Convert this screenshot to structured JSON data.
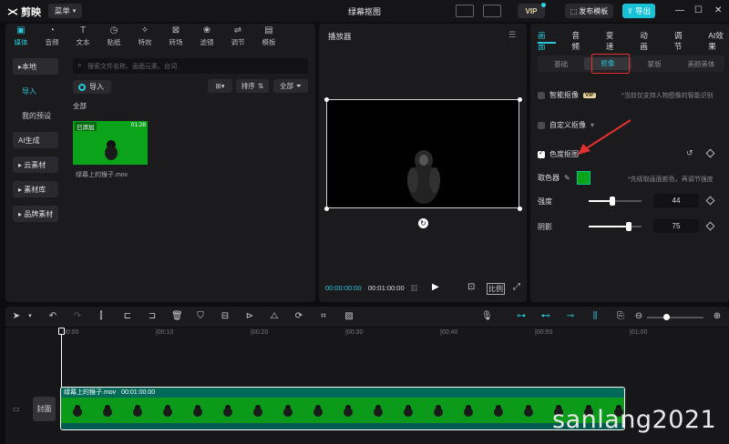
{
  "app": {
    "logo_text": "剪映",
    "menu_label": "菜单",
    "project_title": "绿幕抠图",
    "vip_label": "VIP",
    "publish_label": "发布模板",
    "export_label": "导出"
  },
  "media_tools": [
    {
      "label": "媒体",
      "icon": "media-icon",
      "active": true
    },
    {
      "label": "音频",
      "icon": "audio-icon"
    },
    {
      "label": "文本",
      "icon": "text-icon"
    },
    {
      "label": "贴纸",
      "icon": "sticker-icon"
    },
    {
      "label": "特效",
      "icon": "effects-icon"
    },
    {
      "label": "转场",
      "icon": "transition-icon"
    },
    {
      "label": "滤镜",
      "icon": "filter-icon"
    },
    {
      "label": "调节",
      "icon": "adjust-icon"
    },
    {
      "label": "模板",
      "icon": "template-icon"
    }
  ],
  "sidenav": [
    {
      "label": "▸本地",
      "active": true
    },
    {
      "label": "导入",
      "sub": true,
      "active": true
    },
    {
      "label": "我的预设",
      "sub": true
    },
    {
      "label": "AI生成"
    },
    {
      "label": "▸ 云素材"
    },
    {
      "label": "▸ 素材库"
    },
    {
      "label": "▸ 品牌素材"
    }
  ],
  "media": {
    "search_placeholder": "搜索文件名称、画面元素、台词",
    "import_label": "导入",
    "sort_label": "排序",
    "filter_label": "全部",
    "section_label": "全部",
    "clip": {
      "tag": "已添加",
      "duration": "01:28",
      "name": "绿幕上的猴子.mov"
    }
  },
  "player": {
    "title": "播放器",
    "current_time": "00:00:00:00",
    "total_time": "00:01:00:00",
    "ratio_label": "比例"
  },
  "inspector": {
    "tabs": [
      {
        "label": "画面",
        "active": true
      },
      {
        "label": "音频"
      },
      {
        "label": "变速"
      },
      {
        "label": "动画"
      },
      {
        "label": "调节"
      },
      {
        "label": "AI效果"
      }
    ],
    "subtabs": [
      {
        "label": "基础"
      },
      {
        "label": "抠像",
        "active": true
      },
      {
        "label": "蒙版"
      },
      {
        "label": "美颜美体"
      }
    ],
    "smart_cutout": {
      "label": "智能抠像",
      "vip": "VIP",
      "hint": "*当前仅支持人物图像的智能识别"
    },
    "custom_cutout": {
      "label": "自定义抠像"
    },
    "chroma_key": {
      "label": "色度抠图",
      "checked": true
    },
    "color_picker": {
      "label": "取色器",
      "color": "#0aa31a",
      "hint": "*先吸取画面颜色，再调节强度"
    },
    "intensity": {
      "label": "强度",
      "value": "44",
      "level": 44
    },
    "shadow": {
      "label": "阴影",
      "value": "75",
      "level": 75
    }
  },
  "timeline": {
    "ruler": [
      "00:00",
      "00:10",
      "00:20",
      "00:30",
      "00:40",
      "00:50",
      "01:00"
    ],
    "clip_name": "绿幕上的猴子.mov",
    "clip_duration": "00:01:00:00",
    "cover_label": "封面"
  },
  "watermark": "sanlang2021",
  "colors": {
    "accent": "#27c8dc",
    "highlight_box": "#e53030",
    "arrow": "#e53030",
    "green_screen": "#0aa31a"
  }
}
